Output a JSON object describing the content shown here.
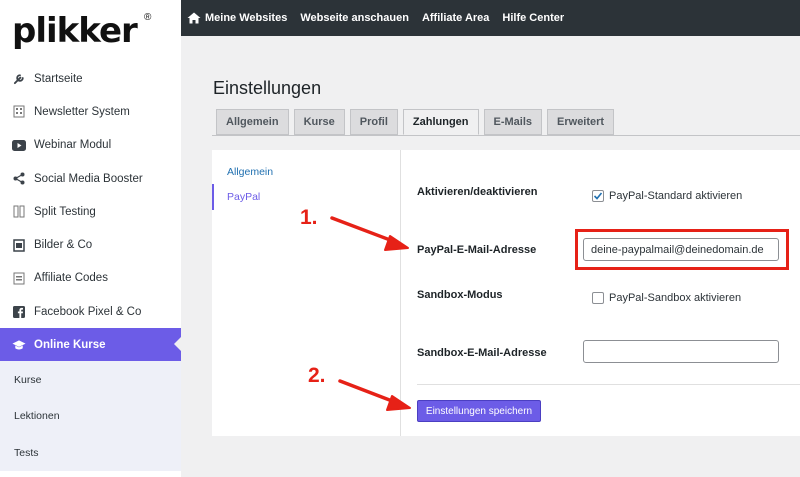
{
  "brand": {
    "logo": "plikker",
    "reg": "®"
  },
  "sidebar": {
    "items": [
      {
        "label": "Startseite",
        "icon": "wrench-icon"
      },
      {
        "label": "Newsletter System",
        "icon": "newsletter-icon"
      },
      {
        "label": "Webinar Modul",
        "icon": "video-icon"
      },
      {
        "label": "Social Media Booster",
        "icon": "share-icon"
      },
      {
        "label": "Split Testing",
        "icon": "split-icon"
      },
      {
        "label": "Bilder & Co",
        "icon": "image-icon"
      },
      {
        "label": "Affiliate Codes",
        "icon": "code-icon"
      },
      {
        "label": "Facebook Pixel & Co",
        "icon": "facebook-icon"
      }
    ],
    "active": {
      "label": "Online Kurse",
      "icon": "graduation-cap-icon"
    },
    "sub_items": [
      "Kurse",
      "Lektionen",
      "Tests"
    ]
  },
  "topbar": {
    "links": [
      "Meine Websites",
      "Webseite anschauen",
      "Affiliate Area",
      "Hilfe Center"
    ]
  },
  "page": {
    "title": "Einstellungen",
    "tabs": [
      "Allgemein",
      "Kurse",
      "Profil",
      "Zahlungen",
      "E-Mails",
      "Erweitert"
    ],
    "active_tab": "Zahlungen",
    "subnav": [
      "Allgemein",
      "PayPal"
    ]
  },
  "form": {
    "enable_label": "Aktivieren/deaktivieren",
    "enable_check_label": "PayPal-Standard aktivieren",
    "enable_checked": true,
    "email_label": "PayPal-E-Mail-Adresse",
    "email_value": "deine-paypalmail@deinedomain.de",
    "sandbox_label": "Sandbox-Modus",
    "sandbox_check_label": "PayPal-Sandbox aktivieren",
    "sandbox_checked": false,
    "sandbox_email_label": "Sandbox-E-Mail-Adresse",
    "sandbox_email_value": "",
    "save_label": "Einstellungen speichern"
  },
  "annotations": {
    "step1": "1.",
    "step2": "2.",
    "color": "#e62117"
  },
  "colors": {
    "accent": "#6c5ce7",
    "topbar": "#2c3338"
  }
}
